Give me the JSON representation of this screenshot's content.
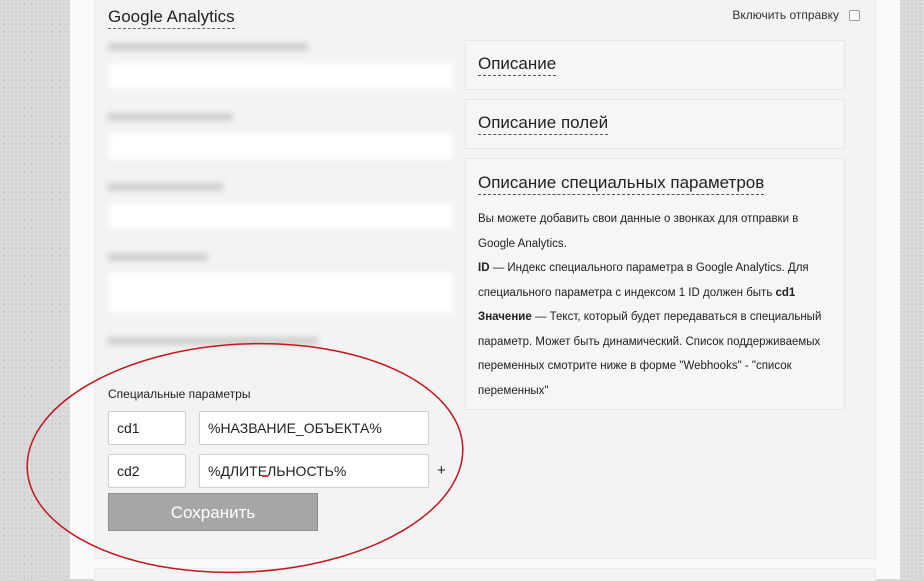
{
  "section": {
    "title": "Google Analytics",
    "toggle_label": "Включить отправку"
  },
  "cards": {
    "description_title": "Описание",
    "fields_title": "Описание полей",
    "special_title": "Описание специальных параметров",
    "special_text_1": "Вы можете добавить свои данные о звонках для отправки в Google Analytics.",
    "special_id_label": "ID",
    "special_id_text": " — Индекс специального параметра в Google Analytics. Для специального параметра с индексом 1 ID должен быть ",
    "special_id_example": "cd1",
    "special_value_label": "Значение",
    "special_value_text": " — Текст, который будет передаваться в специальный параметр. Может быть динамический. Список поддерживаемых переменных смотрите ниже в форме \"Webhooks\" - \"список переменных\""
  },
  "special_params": {
    "label": "Специальные параметры",
    "rows": [
      {
        "id": "cd1",
        "value": "%НАЗВАНИЕ_ОБЪЕКТА%"
      },
      {
        "id": "cd2",
        "value": "%ДЛИТЕЛЬНОСТЬ%"
      }
    ],
    "add_label": "+",
    "save_label": "Сохранить"
  },
  "colors": {
    "annotation_ellipse": "#c0181c",
    "save_button": "#a6a6a6"
  }
}
